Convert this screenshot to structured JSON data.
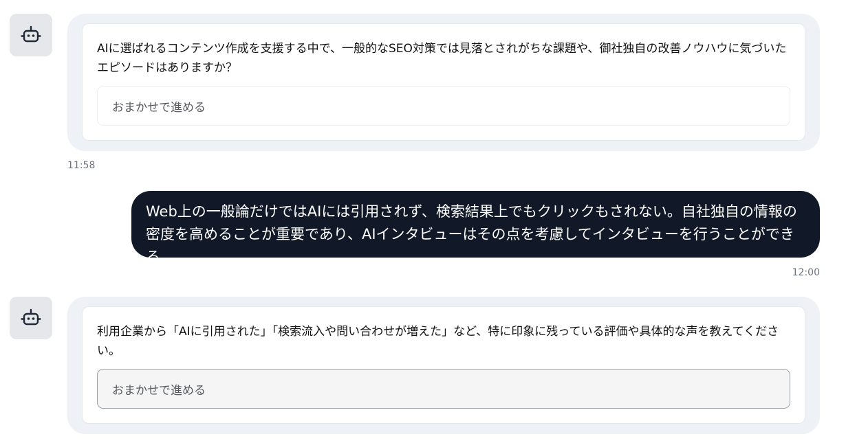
{
  "messages": [
    {
      "role": "bot",
      "avatar_icon": "robot-icon",
      "question": "AIに選ばれるコンテンツ作成を支援する中で、一般的なSEO対策では見落とされがちな課題や、御社独自の改善ノウハウに気づいたエピソードはありますか？",
      "option_label": "おまかせで進める",
      "time": "11:58"
    },
    {
      "role": "user",
      "text": "Web上の一般論だけではAIには引用されず、検索結果上でもクリックもされない。自社独自の情報の密度を高めることが重要であり、AIインタビューはその点を考慮してインタビューを行うことができる。",
      "time": "12:00"
    },
    {
      "role": "bot",
      "avatar_icon": "robot-icon",
      "question": "利用企業から「AIに引用された」「検索流入や問い合わせが増えた」など、特に印象に残っている評価や具体的な声を教えてください。",
      "option_label": "おまかせで進める"
    }
  ],
  "colors": {
    "user_bubble": "#111827",
    "bot_bubble": "#eef1f5",
    "avatar_bg": "#e5e7eb"
  }
}
